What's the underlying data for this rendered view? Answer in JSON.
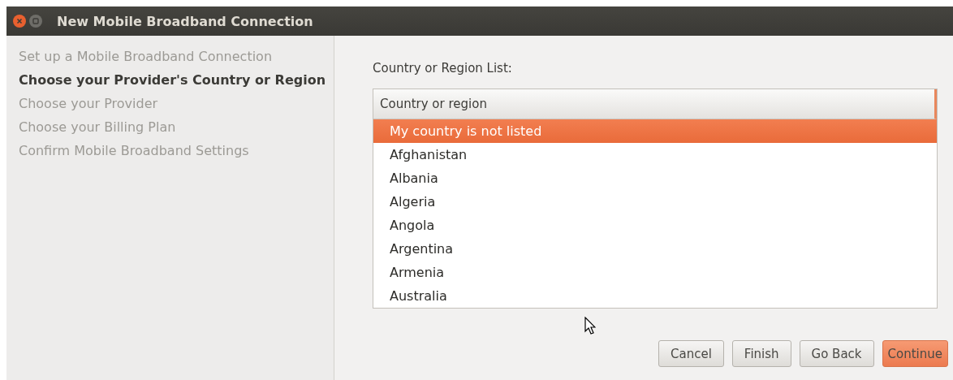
{
  "window": {
    "title": "New Mobile Broadband Connection"
  },
  "steps": [
    {
      "label": "Set up a Mobile Broadband Connection",
      "selected": false
    },
    {
      "label": "Choose your Provider's Country or Region",
      "selected": true
    },
    {
      "label": "Choose your Provider",
      "selected": false
    },
    {
      "label": "Choose your Billing Plan",
      "selected": false
    },
    {
      "label": "Confirm Mobile Broadband Settings",
      "selected": false
    }
  ],
  "list_label": "Country or Region List:",
  "list": {
    "column": "Country or region",
    "rows": [
      {
        "label": "My country is not listed",
        "selected": true
      },
      {
        "label": "Afghanistan",
        "selected": false
      },
      {
        "label": "Albania",
        "selected": false
      },
      {
        "label": "Algeria",
        "selected": false
      },
      {
        "label": "Angola",
        "selected": false
      },
      {
        "label": "Argentina",
        "selected": false
      },
      {
        "label": "Armenia",
        "selected": false
      },
      {
        "label": "Australia",
        "selected": false
      }
    ]
  },
  "buttons": [
    {
      "label": "Cancel",
      "default": false
    },
    {
      "label": "Finish",
      "default": false
    },
    {
      "label": "Go Back",
      "default": false
    },
    {
      "label": "Continue",
      "default": true
    }
  ]
}
